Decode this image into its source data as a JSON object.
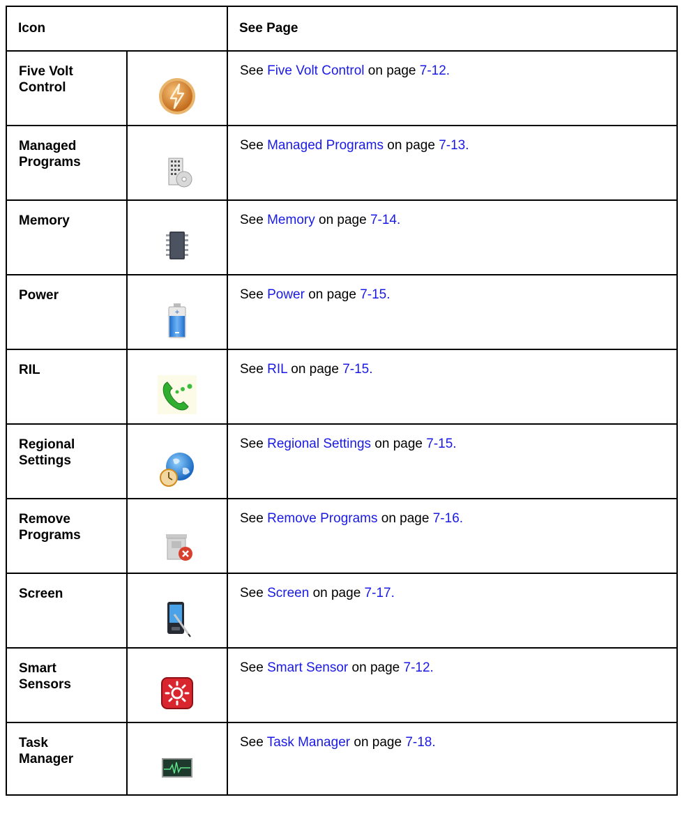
{
  "header": {
    "icon_col": "Icon",
    "page_col": "See Page"
  },
  "rows": [
    {
      "name": "Five Volt\nControl",
      "icon": "lightning-icon",
      "prefix": "See ",
      "link": "Five Volt Control",
      "mid": " on page ",
      "page": "7-12."
    },
    {
      "name": "Managed\nPrograms",
      "icon": "building-disc-icon",
      "prefix": "See ",
      "link": "Managed Programs",
      "mid": " on page ",
      "page": "7-13."
    },
    {
      "name": "Memory",
      "icon": "memory-chip-icon",
      "prefix": "See ",
      "link": "Memory",
      "mid": " on page ",
      "page": "7-14."
    },
    {
      "name": "Power",
      "icon": "battery-icon",
      "prefix": "See ",
      "link": "Power",
      "mid": " on page ",
      "page": "7-15."
    },
    {
      "name": "RIL",
      "icon": "phone-icon",
      "prefix": "See ",
      "link": "RIL",
      "mid": " on page ",
      "page": "7-15."
    },
    {
      "name": "Regional\nSettings",
      "icon": "globe-clock-icon",
      "prefix": "See ",
      "link": "Regional Settings",
      "mid": " on page ",
      "page": "7-15."
    },
    {
      "name": "Remove\nPrograms",
      "icon": "remove-programs-icon",
      "prefix": "See ",
      "link": "Remove Programs",
      "mid": " on page ",
      "page": "7-16."
    },
    {
      "name": "Screen",
      "icon": "stylus-device-icon",
      "prefix": "See ",
      "link": "Screen",
      "mid": " on page ",
      "page": "7-17."
    },
    {
      "name": "Smart\nSensors",
      "icon": "sensor-sun-icon",
      "prefix": "See ",
      "link": "Smart Sensor",
      "mid": " on page ",
      "page": "7-12."
    },
    {
      "name": "Task\nManager",
      "icon": "heartbeat-monitor-icon",
      "prefix": "See ",
      "link": "Task Manager",
      "mid": " on page ",
      "page": "7-18."
    }
  ],
  "colors": {
    "link": "#1a1ae6",
    "border": "#000000"
  }
}
